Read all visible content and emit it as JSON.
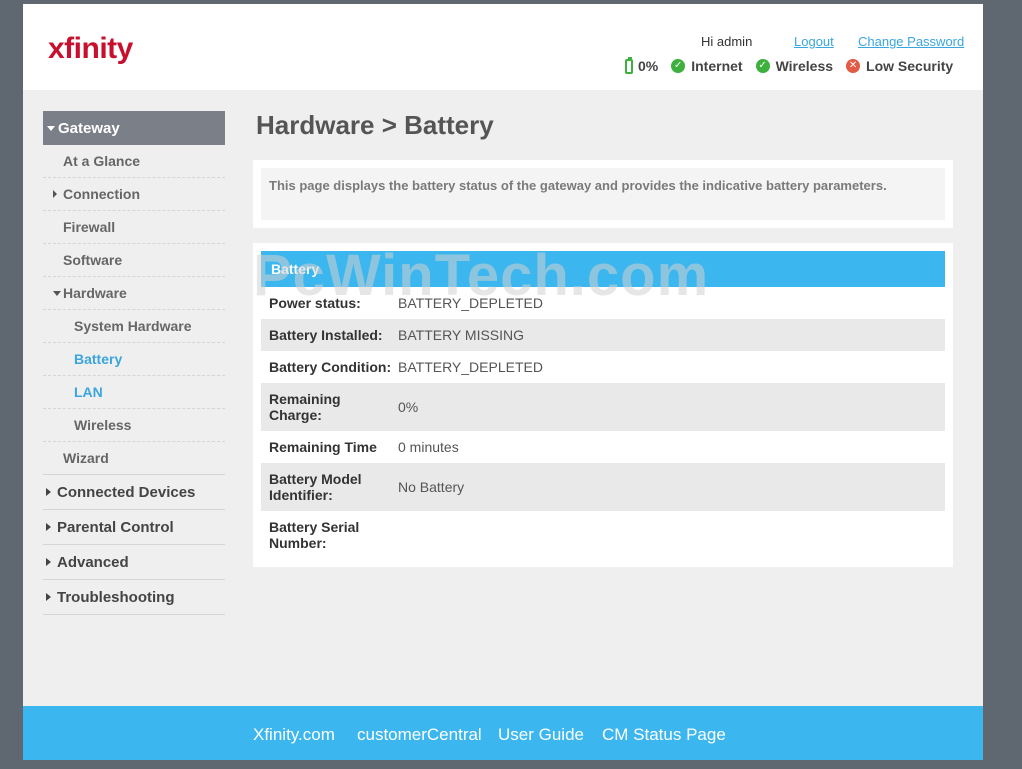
{
  "header": {
    "logo": "xfinity",
    "greeting": "Hi admin",
    "logout": "Logout",
    "change_password": "Change Password",
    "status": [
      {
        "icon": "battery-icon",
        "label": "0%"
      },
      {
        "icon": "check-icon",
        "label": "Internet"
      },
      {
        "icon": "check-icon",
        "label": "Wireless"
      },
      {
        "icon": "x-icon",
        "label": "Low Security"
      }
    ]
  },
  "sidebar": {
    "gateway": "Gateway",
    "gateway_items": [
      "At a Glance",
      "Connection",
      "Firewall",
      "Software",
      "Hardware",
      "System Hardware",
      "Battery",
      "LAN",
      "Wireless",
      "Wizard"
    ],
    "sections": [
      "Connected Devices",
      "Parental Control",
      "Advanced",
      "Troubleshooting"
    ]
  },
  "main": {
    "title": "Hardware > Battery",
    "description": "This page displays the battery status of the gateway and provides the indicative battery parameters.",
    "panel_title": "Battery",
    "rows": [
      {
        "label": "Power status:",
        "value": "BATTERY_DEPLETED"
      },
      {
        "label": "Battery Installed:",
        "value": "BATTERY MISSING"
      },
      {
        "label": "Battery Condition:",
        "value": "BATTERY_DEPLETED"
      },
      {
        "label": "Remaining Charge:",
        "value": "0%"
      },
      {
        "label": "Remaining Time",
        "value": "0 minutes"
      },
      {
        "label": "Battery Model Identifier:",
        "value": "No Battery"
      },
      {
        "label": "Battery Serial Number:",
        "value": ""
      }
    ]
  },
  "watermark": "PcWinTech.com",
  "footer": {
    "links": [
      "Xfinity.com",
      "customerCentral",
      "User Guide",
      "CM Status Page"
    ]
  },
  "colors": {
    "accent": "#3bb6ee",
    "link": "#3aa6dd",
    "brand": "#c8102e",
    "ok": "#3db03d",
    "bad": "#e25b45"
  }
}
